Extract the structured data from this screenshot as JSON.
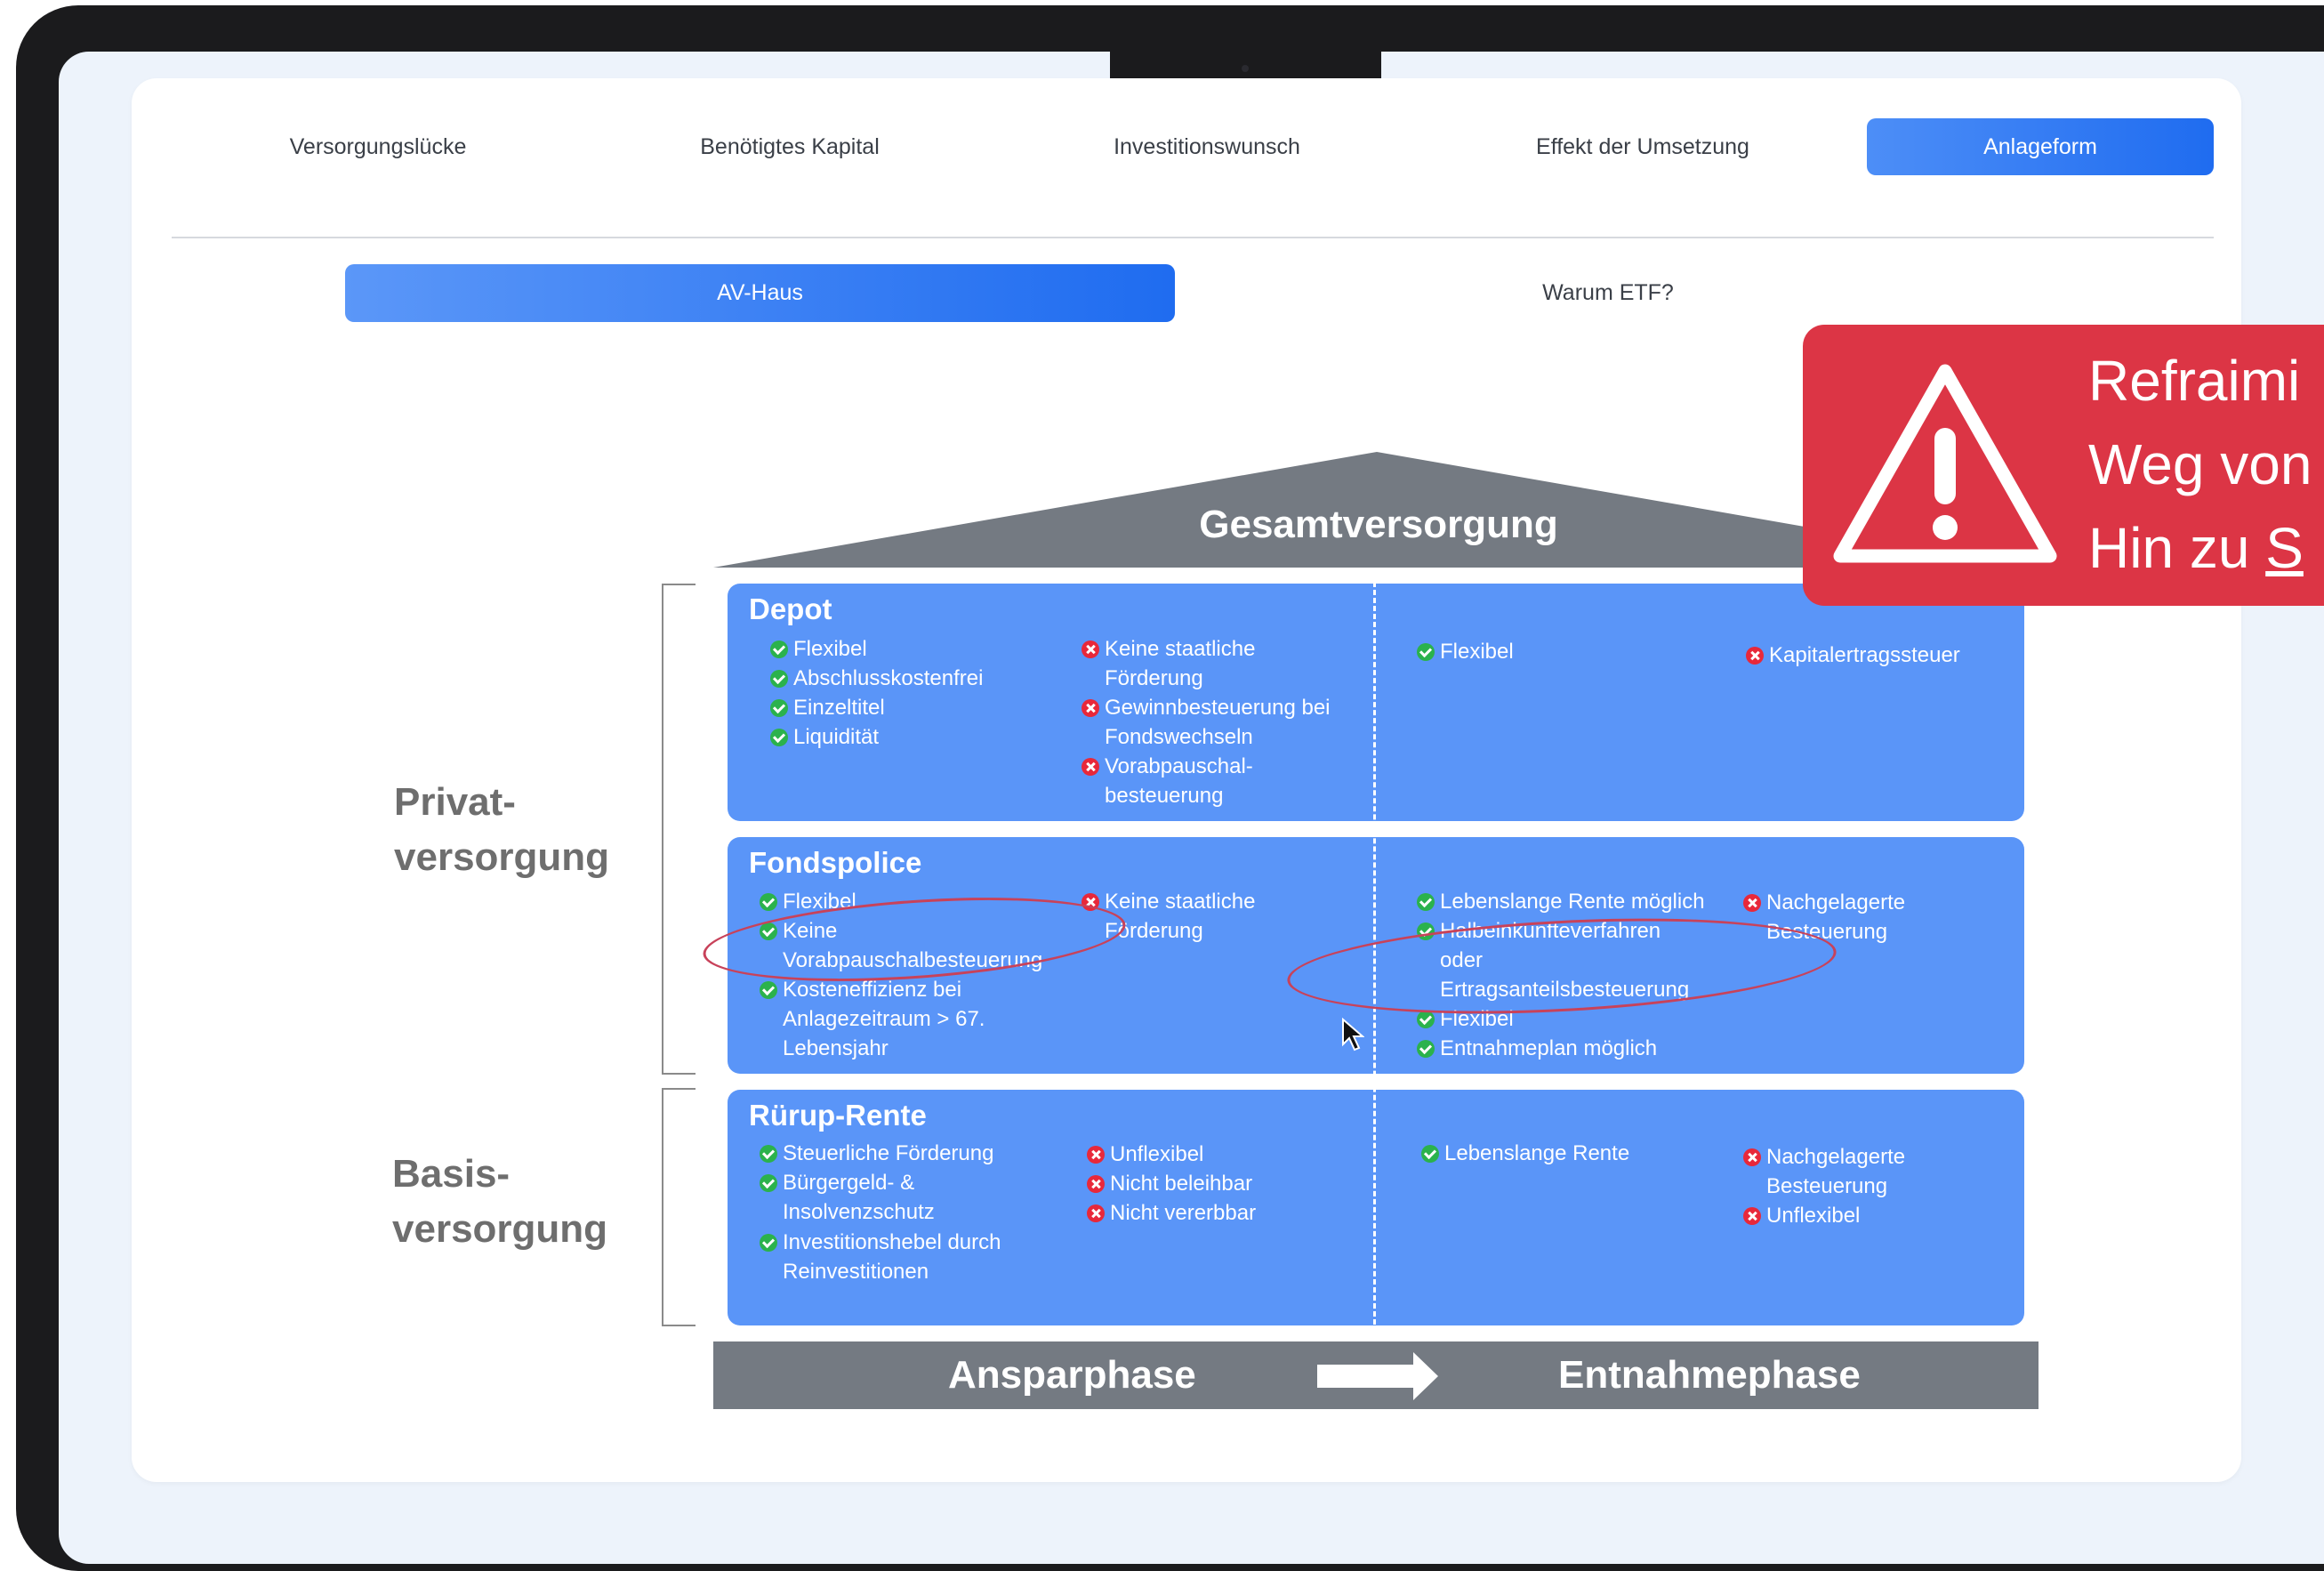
{
  "nav": {
    "tabs": [
      {
        "label": "Versorgungslücke"
      },
      {
        "label": "Benötigtes Kapital"
      },
      {
        "label": "Investitionswunsch"
      },
      {
        "label": "Effekt der Umsetzung"
      },
      {
        "label": "Anlageform",
        "active": true
      }
    ]
  },
  "subnav": {
    "tabs": [
      {
        "label": "AV-Haus",
        "active": true
      },
      {
        "label": "Warum ETF?"
      }
    ]
  },
  "house": {
    "roof_title": "Gesamtversorgung",
    "left_labels": {
      "privat_1": "Privat-",
      "privat_2": "versorgung",
      "basis_1": "Basis-",
      "basis_2": "versorgung"
    },
    "panels": {
      "depot": {
        "title": "Depot",
        "anspar_pros": [
          "Flexibel",
          "Abschlusskostenfrei",
          "Einzeltitel",
          "Liquidität"
        ],
        "anspar_cons": [
          "Keine staatliche",
          "Förderung",
          "Gewinnbesteuerung bei",
          "Fondswechseln",
          "Vorabpauschal-",
          "besteuerung"
        ],
        "entnahme_pros": [
          "Flexibel"
        ],
        "entnahme_cons": [
          "Kapitalertragssteuer"
        ]
      },
      "fondspolice": {
        "title": "Fondspolice",
        "anspar_pros": [
          "Flexibel",
          "Keine",
          "Vorabpauschalbesteuerung",
          "Kosteneffizienz bei",
          "Anlagezeitraum > 67.",
          "Lebensjahr"
        ],
        "anspar_cons": [
          "Keine staatliche",
          "Förderung"
        ],
        "entnahme_pros": [
          "Lebenslange Rente möglich",
          "Halbeinkünfteverfahren",
          "oder",
          "Ertragsanteilsbesteuerung",
          "Flexibel",
          "Entnahmeplan möglich"
        ],
        "entnahme_cons": [
          "Nachgelagerte",
          "Besteuerung"
        ]
      },
      "ruerup": {
        "title": "Rürup-Rente",
        "anspar_pros": [
          "Steuerliche Förderung",
          "Bürgergeld- &",
          "Insolvenzschutz",
          "Investitionshebel durch",
          "Reinvestitionen"
        ],
        "anspar_cons": [
          "Unflexibel",
          "Nicht beleihbar",
          "Nicht vererbbar"
        ],
        "entnahme_pros": [
          "Lebenslange Rente"
        ],
        "entnahme_cons": [
          "Nachgelagerte",
          "Besteuerung",
          "Unflexibel"
        ]
      }
    },
    "phases": {
      "left": "Ansparphase",
      "right": "Entnahmephase"
    }
  },
  "warning": {
    "line1": "Refraimi",
    "line2": "Weg von",
    "line3_prefix": "Hin zu ",
    "line3_underlined": "S"
  },
  "colors": {
    "accent": "#1f6cf0",
    "panel": "#5a95f8",
    "roof": "#747a82",
    "warning": "#dc3545",
    "check": "#2bb24c",
    "cross": "#e8283a",
    "annotation": "#c8425a"
  }
}
